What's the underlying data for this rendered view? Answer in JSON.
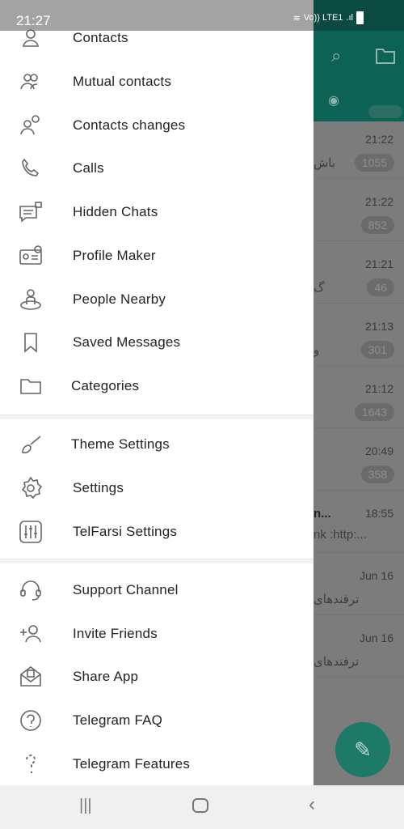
{
  "status_bar": {
    "time": "21:27",
    "network": "Vo)) LTE1"
  },
  "drawer": {
    "items": [
      {
        "label": "Contacts",
        "icon": "contact-icon"
      },
      {
        "label": "Mutual contacts",
        "icon": "mutual-contacts-icon"
      },
      {
        "label": "Contacts changes",
        "icon": "contacts-changes-icon"
      },
      {
        "label": "Calls",
        "icon": "phone-icon"
      },
      {
        "label": "Hidden Chats",
        "icon": "hidden-chat-icon"
      },
      {
        "label": "Profile Maker",
        "icon": "profile-card-icon"
      },
      {
        "label": "People Nearby",
        "icon": "people-nearby-icon"
      },
      {
        "label": "Saved Messages",
        "icon": "bookmark-icon"
      },
      {
        "label": "Categories",
        "icon": "folder-icon"
      },
      {
        "label": "Theme Settings",
        "icon": "brush-icon"
      },
      {
        "label": "Settings",
        "icon": "gear-icon"
      },
      {
        "label": "TelFarsi Settings",
        "icon": "sliders-icon"
      },
      {
        "label": "Support Channel",
        "icon": "headset-icon"
      },
      {
        "label": "Invite Friends",
        "icon": "add-user-icon"
      },
      {
        "label": "Share App",
        "icon": "share-app-icon"
      },
      {
        "label": "Telegram FAQ",
        "icon": "question-circle-icon"
      },
      {
        "label": "Telegram Features",
        "icon": "question-icon"
      }
    ]
  },
  "chats": [
    {
      "time": "21:22",
      "badge": "1055",
      "snippet": "باش"
    },
    {
      "time": "21:22",
      "badge": "852",
      "snippet": ""
    },
    {
      "time": "21:21",
      "badge": "46",
      "snippet": "گ"
    },
    {
      "time": "21:13",
      "badge": "301",
      "snippet": "و"
    },
    {
      "time": "21:12",
      "badge": "1643",
      "snippet": ""
    },
    {
      "time": "20:49",
      "badge": "358",
      "snippet": ""
    },
    {
      "time": "18:55",
      "badge": "",
      "snippet": "nk :http:...",
      "title": "n..."
    },
    {
      "time": "Jun 16",
      "badge": "",
      "snippet": "ترفندهای"
    },
    {
      "time": "Jun 16",
      "badge": "",
      "snippet": "ترفندهای"
    }
  ]
}
